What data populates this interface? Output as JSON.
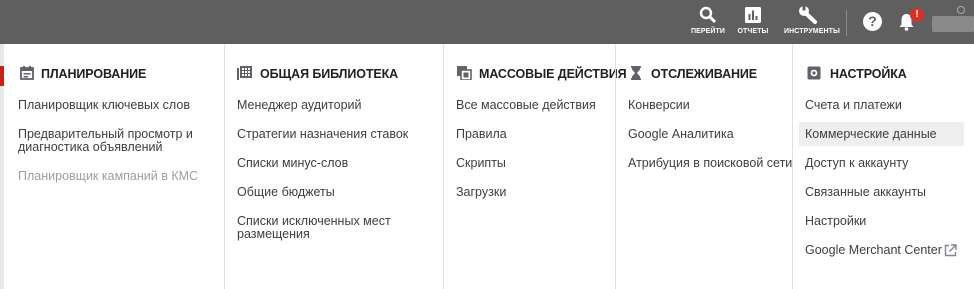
{
  "topbar": {
    "go_label": "ПЕРЕЙТИ",
    "reports_label": "ОТЧЕТЫ",
    "tools_label": "ИНСТРУМЕНТЫ",
    "help_glyph": "?",
    "notification_badge": "!"
  },
  "columns": {
    "planning": {
      "title": "ПЛАНИРОВАНИЕ",
      "icon": "calendar-icon",
      "items": [
        "Планировщик ключевых слов",
        "Предварительный просмотр и",
        "диагностика объявлений",
        "Планировщик кампаний в КМС"
      ]
    },
    "shared_library": {
      "title": "ОБЩАЯ БИБЛИОТЕКА",
      "icon": "library-grid-icon",
      "items": [
        "Менеджер аудиторий",
        "Стратегии назначения ставок",
        "Списки минус-слов",
        "Общие бюджеты",
        "Списки исключенных мест",
        "размещения"
      ]
    },
    "bulk_actions": {
      "title": "МАССОВЫЕ ДЕЙСТВИЯ",
      "icon": "copy-stack-icon",
      "items": [
        "Все массовые действия",
        "Правила",
        "Скрипты",
        "Загрузки"
      ]
    },
    "tracking": {
      "title": "ОТСЛЕЖИВАНИЕ",
      "icon": "hourglass-icon",
      "items": [
        "Конверсии",
        "Google Аналитика",
        "Атрибуция в поисковой сети"
      ]
    },
    "setup": {
      "title": "НАСТРОЙКА",
      "icon": "gear-box-icon",
      "items": [
        "Счета и платежи",
        "Коммерческие данные",
        "Доступ к аккаунту",
        "Связанные аккаунты",
        "Настройки",
        "Google Merchant Center"
      ]
    }
  },
  "colors": {
    "topbar": "#5f5f5f",
    "text": "#3c4043",
    "disabled": "#9aa0a6",
    "highlight": "#eeeeee",
    "badge": "#d93025"
  }
}
